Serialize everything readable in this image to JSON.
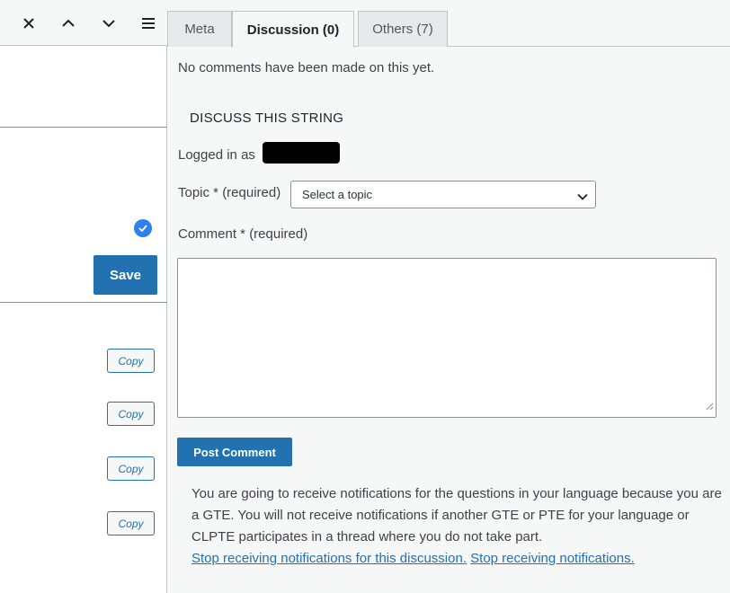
{
  "toolbar": {
    "icons": [
      "close-icon",
      "chevron-up-icon",
      "chevron-down-icon",
      "menu-icon"
    ]
  },
  "left": {
    "save_label": "Save",
    "copy_labels": [
      "Copy",
      "Copy",
      "Copy",
      "Copy"
    ]
  },
  "tabs": [
    {
      "label": "Meta"
    },
    {
      "label": "Discussion (0)",
      "active": true
    },
    {
      "label": "Others (7)"
    }
  ],
  "discussion": {
    "no_comments": "No comments have been made on this yet.",
    "heading": "DISCUSS THIS STRING",
    "logged_in_prefix": "Logged in as",
    "topic_label": "Topic * (required)",
    "topic_placeholder": "Select a topic",
    "comment_label": "Comment * (required)",
    "post_button": "Post Comment",
    "notice_text": "You are going to receive notifications for the questions in your language because you are a GTE. You will not receive notifications if another GTE or PTE for your language or CLPTE participates in a thread where you do not take part.",
    "stop_discussion_link": "Stop receiving notifications for this discussion.",
    "stop_all_link": "Stop receiving notifications."
  },
  "colors": {
    "accent": "#2271b1",
    "check_badge": "#2f80ed",
    "panel_bg": "#f6f7f7"
  }
}
